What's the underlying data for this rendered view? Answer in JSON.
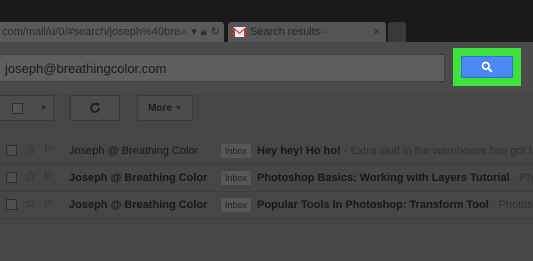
{
  "browser": {
    "url": "com/mail/u/0/#search/joseph%40brea",
    "tab_title": "Search results - ",
    "tab_close": "×"
  },
  "search": {
    "query": "joseph@breathingcolor.com",
    "highlight_color": "#3de23b",
    "button_color": "#4a89f2"
  },
  "toolbar": {
    "more_label": "More"
  },
  "emails": [
    {
      "sender": "Joseph @ Breathing Color",
      "label": "Inbox",
      "subject": "Hey hey! Ho ho!",
      "snippet": " - Extra stuff in the warehouse has got to go! S",
      "unread": false
    },
    {
      "sender": "Joseph @ Breathing Color",
      "label": "Inbox",
      "subject": "Photoshop Basics: Working with Layers Tutorial",
      "snippet": " - Photosh",
      "unread": true
    },
    {
      "sender": "Joseph @ Breathing Color",
      "label": "Inbox",
      "subject": "Popular Tools In Photoshop: Transform Tool",
      "snippet": " - Photosho",
      "unread": true
    }
  ]
}
